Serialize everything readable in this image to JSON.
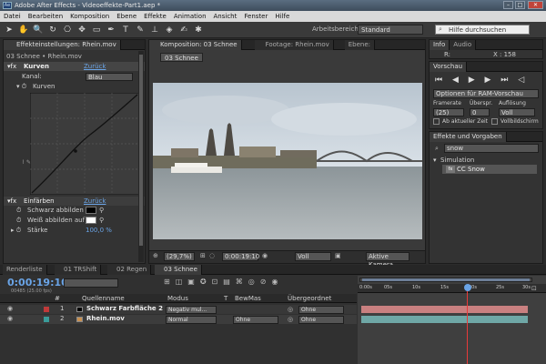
{
  "titlebar": {
    "logo": "Ae",
    "title": "Adobe After Effects - Videoeffekte-Part1.aep *"
  },
  "menu": [
    "Datei",
    "Bearbeiten",
    "Komposition",
    "Ebene",
    "Effekte",
    "Animation",
    "Ansicht",
    "Fenster",
    "Hilfe"
  ],
  "toolbar": {
    "workspace_label": "Arbeitsbereich:",
    "workspace_value": "Standard",
    "help_placeholder": "Hilfe durchsuchen"
  },
  "effects_panel": {
    "tab": "Effekteinstellungen: Rhein.mov",
    "path": "03 Schnee • Rhein.mov",
    "curves": {
      "name": "Kurven",
      "reset": "Zurück",
      "channel_label": "Kanal:",
      "channel_value": "Blau",
      "sub": "Kurven"
    },
    "tint": {
      "name": "Einfärben",
      "reset": "Zurück",
      "black_label": "Schwarz abbilden",
      "white_label": "Weiß abbilden auf",
      "amount_label": "Stärke",
      "amount_value": "100,0 %"
    }
  },
  "comp_panel": {
    "tab_comp": "Komposition: 03 Schnee",
    "tab_footage": "Footage: Rhein.mov",
    "tab_layer": "Ebene:",
    "subtab": "03 Schnee",
    "zoom": "(29,7%)",
    "timecode": "0:00:19:10",
    "quality": "Voll",
    "camera": "Aktive Kamera"
  },
  "info_panel": {
    "tab_info": "Info",
    "tab_audio": "Audio",
    "r_label": "R:",
    "x_label": "X : 158"
  },
  "preview_panel": {
    "tab": "Vorschau",
    "ram_option": "Optionen für RAM-Vorschau",
    "framerate_label": "Framerate",
    "skip_label": "Überspr.",
    "resolution_label": "Auflösung",
    "framerate_value": "(25)",
    "skip_value": "0",
    "resolution_value": "Voll",
    "from_current": "Ab aktueller Zeit",
    "fullscreen": "Vollbildschirm"
  },
  "effects_presets": {
    "tab": "Effekte und Vorgaben",
    "search_value": "snow",
    "category": "Simulation",
    "item": "CC Snow"
  },
  "timeline": {
    "tabs": [
      "Renderliste",
      "01 TRShift",
      "02 Regen",
      "03 Schnee"
    ],
    "timecode": "0:00:19:10",
    "frames": "00485 (25.00 fps)",
    "columns": {
      "num": "#",
      "source": "Quellenname",
      "mode": "Modus",
      "t": "T",
      "trkmat": "BewMas",
      "parent": "Übergeordnet"
    },
    "layers": [
      {
        "num": "1",
        "name": "Schwarz Farbfläche 2",
        "mode": "Negativ mul...",
        "trkmat": "",
        "parent": "Ohne",
        "color": "#c03a3a"
      },
      {
        "num": "2",
        "name": "Rhein.mov",
        "mode": "Normal",
        "trkmat": "Ohne",
        "parent": "Ohne",
        "color": "#3a9c9a"
      }
    ],
    "ruler": [
      "0:00s",
      "05s",
      "10s",
      "15s",
      "20s",
      "25s",
      "30s"
    ]
  },
  "colors": {
    "accent": "#6aa4e6",
    "playhead": "#e83a3a",
    "layer1_bar": "#c98080",
    "layer2_bar": "#6fa7a6"
  }
}
